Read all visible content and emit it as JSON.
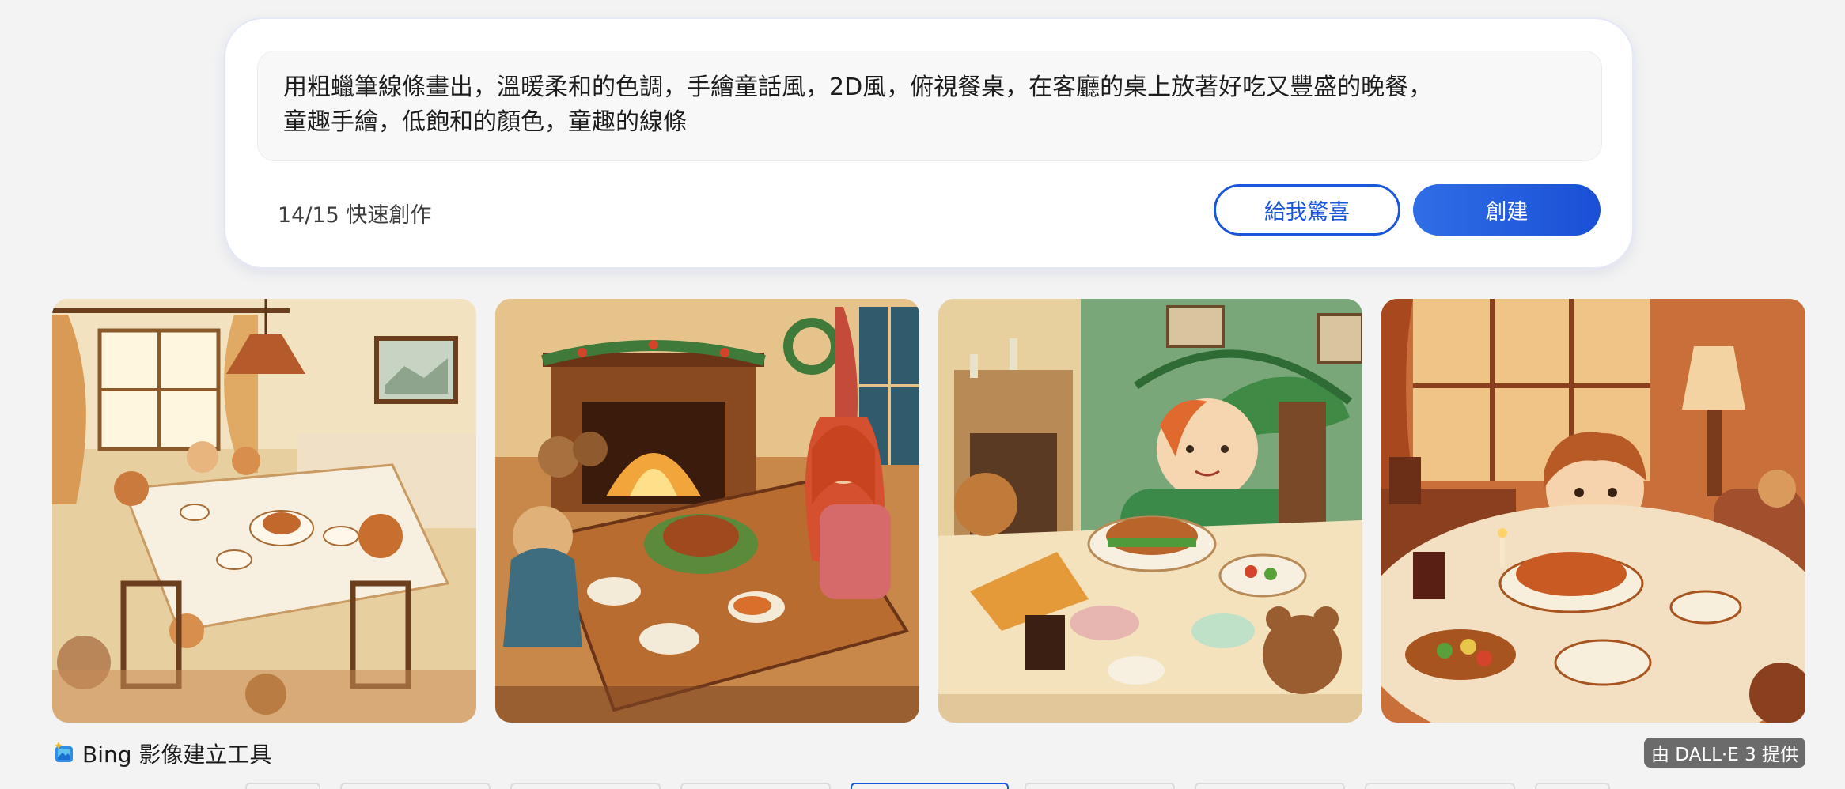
{
  "prompt": {
    "text": "用粗蠟筆線條畫出，溫暖柔和的色調，手繪童話風，2D風，俯視餐桌，在客廳的桌上放著好吃又豐盛的晚餐，\n童趣手繪，低飽和的顏色，童趣的線條"
  },
  "boosts": {
    "label": "14/15 快速創作"
  },
  "buttons": {
    "surprise": "給我驚喜",
    "create": "創建"
  },
  "footer": {
    "brand": "Bing 影像建立工具",
    "powered_by": "由 DALL·E 3 提供"
  },
  "colors": {
    "accent": "#1a56db",
    "background": "#f3f3f3"
  },
  "icons": {
    "brand": "image-creator-sparkle-icon"
  }
}
